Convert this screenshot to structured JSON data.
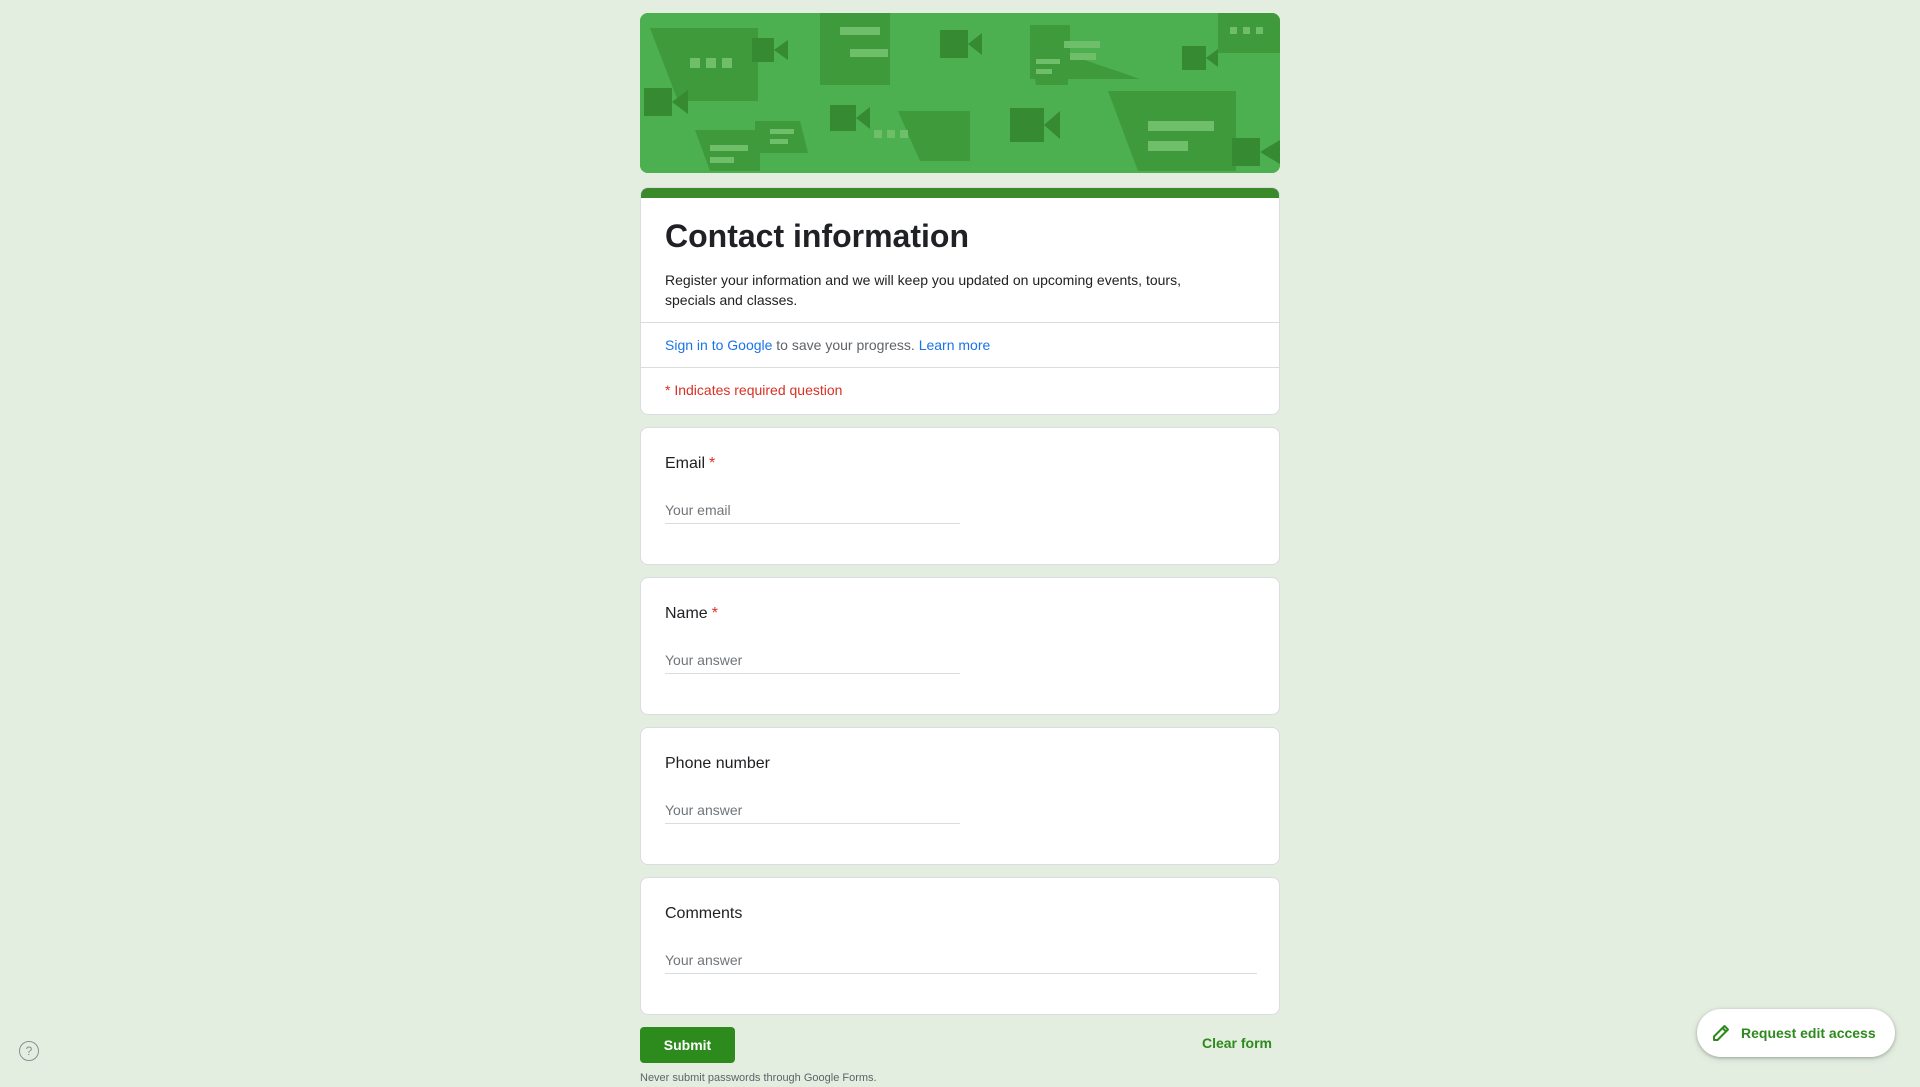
{
  "form": {
    "title": "Contact information",
    "description": "Register your information and we will keep you updated on upcoming events, tours, specials and classes.",
    "signin_link": "Sign in to Google",
    "signin_text": " to save your progress. ",
    "learn_more": "Learn more",
    "required_note": "* Indicates required question"
  },
  "questions": [
    {
      "label": "Email",
      "required_mark": "*",
      "placeholder": "Your email"
    },
    {
      "label": "Name",
      "required_mark": "*",
      "placeholder": "Your answer"
    },
    {
      "label": "Phone number",
      "placeholder": "Your answer"
    },
    {
      "label": "Comments",
      "placeholder": "Your answer"
    }
  ],
  "actions": {
    "submit": "Submit",
    "clear": "Clear form"
  },
  "footer": {
    "note": "Never submit passwords through Google Forms."
  },
  "help": {
    "icon": "help-circle-icon",
    "glyph": "?"
  },
  "edit_access": {
    "label": "Request edit access",
    "icon": "pencil-icon"
  },
  "colors": {
    "accent": "#2d8a1c",
    "banner": "#4caf50",
    "background": "#e3eee1",
    "required": "#d93025",
    "link": "#1a73e8"
  }
}
